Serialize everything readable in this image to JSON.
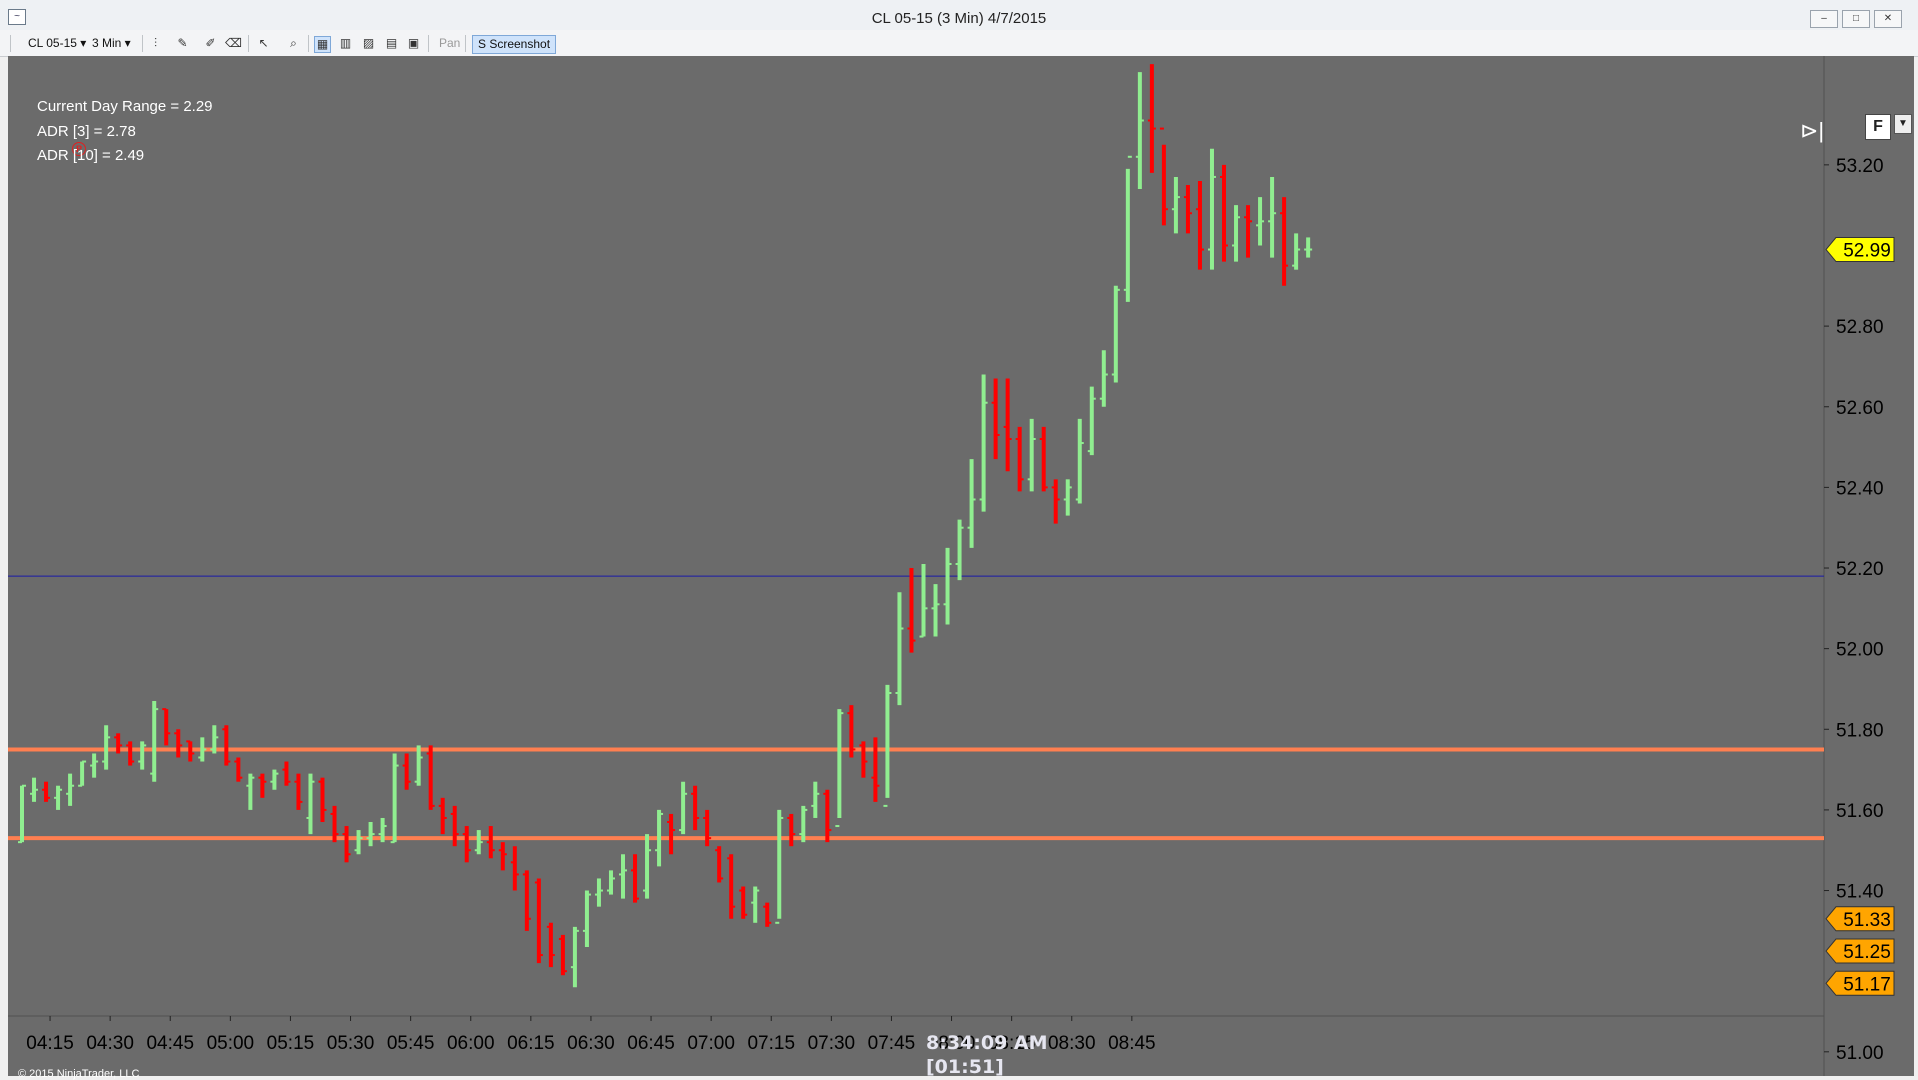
{
  "window": {
    "title": "CL 05-15 (3 Min)  4/7/2015",
    "minimize_label": "‒",
    "maximize_label": "□",
    "close_label": "✕"
  },
  "toolbar": {
    "instrument": "CL 05-15 ▾",
    "interval": "3 Min ▾",
    "pan_label": "Pan",
    "screenshot_label": "S Screenshot"
  },
  "indicators": {
    "current_day_range": "Current Day Range = 2.29",
    "adr3": "ADR [3] = 2.78",
    "adr10": "ADR [10] = 2.49"
  },
  "clock": {
    "time": "8:34:09 AM",
    "remaining": "[01:51]"
  },
  "copyright": "© 2015 NinjaTrader, LLC",
  "f_button": "F",
  "colors": {
    "background": "#6b6b6b",
    "up_bar": "#90ee90",
    "down_bar": "#ff0000",
    "level_line": "#ff7f50",
    "blue_line": "#1a1aa8",
    "price_badge": "#ffff00",
    "zone_badge": "#ffa500"
  },
  "chart_data": {
    "type": "bar",
    "title": "CL 05-15 (3 Min)  4/7/2015",
    "bar_interval_minutes": 3,
    "xlabel": "",
    "ylabel": "",
    "x_tick_labels": [
      "04:15",
      "04:30",
      "04:45",
      "05:00",
      "05:15",
      "05:30",
      "05:45",
      "06:00",
      "06:15",
      "06:30",
      "06:45",
      "07:00",
      "07:15",
      "07:30",
      "07:45",
      "08:00",
      "08:15",
      "08:30",
      "08:45"
    ],
    "y_tick_labels": [
      "53.20",
      "52.80",
      "52.60",
      "52.40",
      "52.20",
      "52.00",
      "51.80",
      "51.60",
      "51.40",
      "51.00"
    ],
    "ylim": [
      50.94,
      53.47
    ],
    "first_bar_time": "04:08",
    "ohlc": [
      [
        51.52,
        51.66,
        51.52,
        51.66
      ],
      [
        51.64,
        51.68,
        51.62,
        51.65
      ],
      [
        51.65,
        51.67,
        51.62,
        51.63
      ],
      [
        51.63,
        51.66,
        51.6,
        51.65
      ],
      [
        51.64,
        51.69,
        51.61,
        51.66
      ],
      [
        51.66,
        51.72,
        51.66,
        51.72
      ],
      [
        51.71,
        51.74,
        51.68,
        51.72
      ],
      [
        51.72,
        51.81,
        51.7,
        51.78
      ],
      [
        51.78,
        51.79,
        51.74,
        51.76
      ],
      [
        51.76,
        51.77,
        51.71,
        51.72
      ],
      [
        51.72,
        51.77,
        51.7,
        51.76
      ],
      [
        51.69,
        51.87,
        51.67,
        51.85
      ],
      [
        51.85,
        51.85,
        51.76,
        51.79
      ],
      [
        51.79,
        51.8,
        51.73,
        51.76
      ],
      [
        51.77,
        51.77,
        51.72,
        51.74
      ],
      [
        51.73,
        51.78,
        51.72,
        51.75
      ],
      [
        51.75,
        51.81,
        51.74,
        51.78
      ],
      [
        51.8,
        51.81,
        51.71,
        51.72
      ],
      [
        51.72,
        51.73,
        51.67,
        51.68
      ],
      [
        51.66,
        51.69,
        51.6,
        51.68
      ],
      [
        51.68,
        51.69,
        51.63,
        51.67
      ],
      [
        51.67,
        51.7,
        51.65,
        51.69
      ],
      [
        51.7,
        51.72,
        51.66,
        51.67
      ],
      [
        51.67,
        51.69,
        51.6,
        51.62
      ],
      [
        51.58,
        51.69,
        51.54,
        51.67
      ],
      [
        51.67,
        51.68,
        51.57,
        51.6
      ],
      [
        51.59,
        51.61,
        51.52,
        51.54
      ],
      [
        51.54,
        51.56,
        51.47,
        51.49
      ],
      [
        51.5,
        51.55,
        51.49,
        51.53
      ],
      [
        51.53,
        51.57,
        51.51,
        51.54
      ],
      [
        51.54,
        51.58,
        51.52,
        51.56
      ],
      [
        51.52,
        51.74,
        51.52,
        51.71
      ],
      [
        51.71,
        51.74,
        51.65,
        51.67
      ],
      [
        51.67,
        51.76,
        51.66,
        51.73
      ],
      [
        51.74,
        51.76,
        51.6,
        51.61
      ],
      [
        51.61,
        51.63,
        51.54,
        51.58
      ],
      [
        51.59,
        51.61,
        51.51,
        51.54
      ],
      [
        51.54,
        51.56,
        51.47,
        51.5
      ],
      [
        51.5,
        51.55,
        51.49,
        51.52
      ],
      [
        51.52,
        51.56,
        51.48,
        51.5
      ],
      [
        51.5,
        51.52,
        51.45,
        51.49
      ],
      [
        51.47,
        51.51,
        51.4,
        51.44
      ],
      [
        51.44,
        51.45,
        51.3,
        51.33
      ],
      [
        51.42,
        51.43,
        51.22,
        51.24
      ],
      [
        51.31,
        51.32,
        51.21,
        51.24
      ],
      [
        51.28,
        51.29,
        51.19,
        51.2
      ],
      [
        51.21,
        51.31,
        51.16,
        51.3
      ],
      [
        51.3,
        51.4,
        51.26,
        51.39
      ],
      [
        51.39,
        51.43,
        51.36,
        51.4
      ],
      [
        51.4,
        51.45,
        51.39,
        51.43
      ],
      [
        51.44,
        51.49,
        51.38,
        51.45
      ],
      [
        51.45,
        51.49,
        51.37,
        51.38
      ],
      [
        51.4,
        51.54,
        51.38,
        51.5
      ],
      [
        51.5,
        51.6,
        51.46,
        51.59
      ],
      [
        51.57,
        51.59,
        51.49,
        51.55
      ],
      [
        51.55,
        51.67,
        51.54,
        51.64
      ],
      [
        51.64,
        51.66,
        51.55,
        51.58
      ],
      [
        51.58,
        51.6,
        51.51,
        51.53
      ],
      [
        51.5,
        51.51,
        51.42,
        51.43
      ],
      [
        51.48,
        51.49,
        51.33,
        51.36
      ],
      [
        51.4,
        51.41,
        51.33,
        51.34
      ],
      [
        51.37,
        51.41,
        51.32,
        51.4
      ],
      [
        51.36,
        51.37,
        51.31,
        51.32
      ],
      [
        51.32,
        51.6,
        51.33,
        51.58
      ],
      [
        51.58,
        51.59,
        51.51,
        51.54
      ],
      [
        51.54,
        51.61,
        51.52,
        51.6
      ],
      [
        51.61,
        51.67,
        51.58,
        51.64
      ],
      [
        51.64,
        51.65,
        51.52,
        51.55
      ],
      [
        51.56,
        51.85,
        51.58,
        51.84
      ],
      [
        51.84,
        51.86,
        51.73,
        51.75
      ],
      [
        51.76,
        51.77,
        51.68,
        51.72
      ],
      [
        51.68,
        51.78,
        51.62,
        51.66
      ],
      [
        51.61,
        51.91,
        51.63,
        51.89
      ],
      [
        51.89,
        52.14,
        51.86,
        52.05
      ],
      [
        52.05,
        52.2,
        51.99,
        52.02
      ],
      [
        52.03,
        52.21,
        52.03,
        52.1
      ],
      [
        52.1,
        52.16,
        52.03,
        52.11
      ],
      [
        52.11,
        52.25,
        52.06,
        52.21
      ],
      [
        52.21,
        52.32,
        52.17,
        52.3
      ],
      [
        52.3,
        52.47,
        52.25,
        52.37
      ],
      [
        52.37,
        52.68,
        52.34,
        52.61
      ],
      [
        52.61,
        52.67,
        52.47,
        52.53
      ],
      [
        52.55,
        52.67,
        52.44,
        52.52
      ],
      [
        52.52,
        52.55,
        52.39,
        52.42
      ],
      [
        52.42,
        52.57,
        52.39,
        52.52
      ],
      [
        52.52,
        52.55,
        52.39,
        52.4
      ],
      [
        52.4,
        52.42,
        52.31,
        52.37
      ],
      [
        52.37,
        52.42,
        52.33,
        52.4
      ],
      [
        52.37,
        52.57,
        52.36,
        52.51
      ],
      [
        52.49,
        52.65,
        52.48,
        52.62
      ],
      [
        52.62,
        52.74,
        52.6,
        52.68
      ],
      [
        52.68,
        52.9,
        52.66,
        52.89
      ],
      [
        52.89,
        53.19,
        52.86,
        53.22
      ],
      [
        53.22,
        53.43,
        53.14,
        53.31
      ],
      [
        53.31,
        53.45,
        53.18,
        53.29
      ],
      [
        53.29,
        53.25,
        53.05,
        53.09
      ],
      [
        53.09,
        53.17,
        53.03,
        53.12
      ],
      [
        53.12,
        53.15,
        53.03,
        53.08
      ],
      [
        53.09,
        53.16,
        52.94,
        52.99
      ],
      [
        52.99,
        53.24,
        52.94,
        53.17
      ],
      [
        53.17,
        53.2,
        52.96,
        53.0
      ],
      [
        53.0,
        53.1,
        52.96,
        53.07
      ],
      [
        53.07,
        53.1,
        52.97,
        53.06
      ],
      [
        53.05,
        53.12,
        53.0,
        53.06
      ],
      [
        53.06,
        53.17,
        52.97,
        53.08
      ],
      [
        53.08,
        53.12,
        52.9,
        52.95
      ],
      [
        52.95,
        53.03,
        52.94,
        52.99
      ],
      [
        52.99,
        53.02,
        52.97,
        52.99
      ]
    ],
    "horizontal_lines": [
      {
        "name": "upper level",
        "value": 51.75,
        "color": "#ff7f50"
      },
      {
        "name": "lower level",
        "value": 51.53,
        "color": "#ff7f50"
      },
      {
        "name": "blue line",
        "value": 52.18,
        "color": "#1a1aa8"
      }
    ],
    "price_badges": [
      {
        "value": "52.99",
        "color": "#ffff00"
      },
      {
        "value": "51.33",
        "color": "#ffa500"
      },
      {
        "value": "51.25",
        "color": "#ffa500"
      },
      {
        "value": "51.17",
        "color": "#ffa500"
      }
    ],
    "grid": false
  }
}
